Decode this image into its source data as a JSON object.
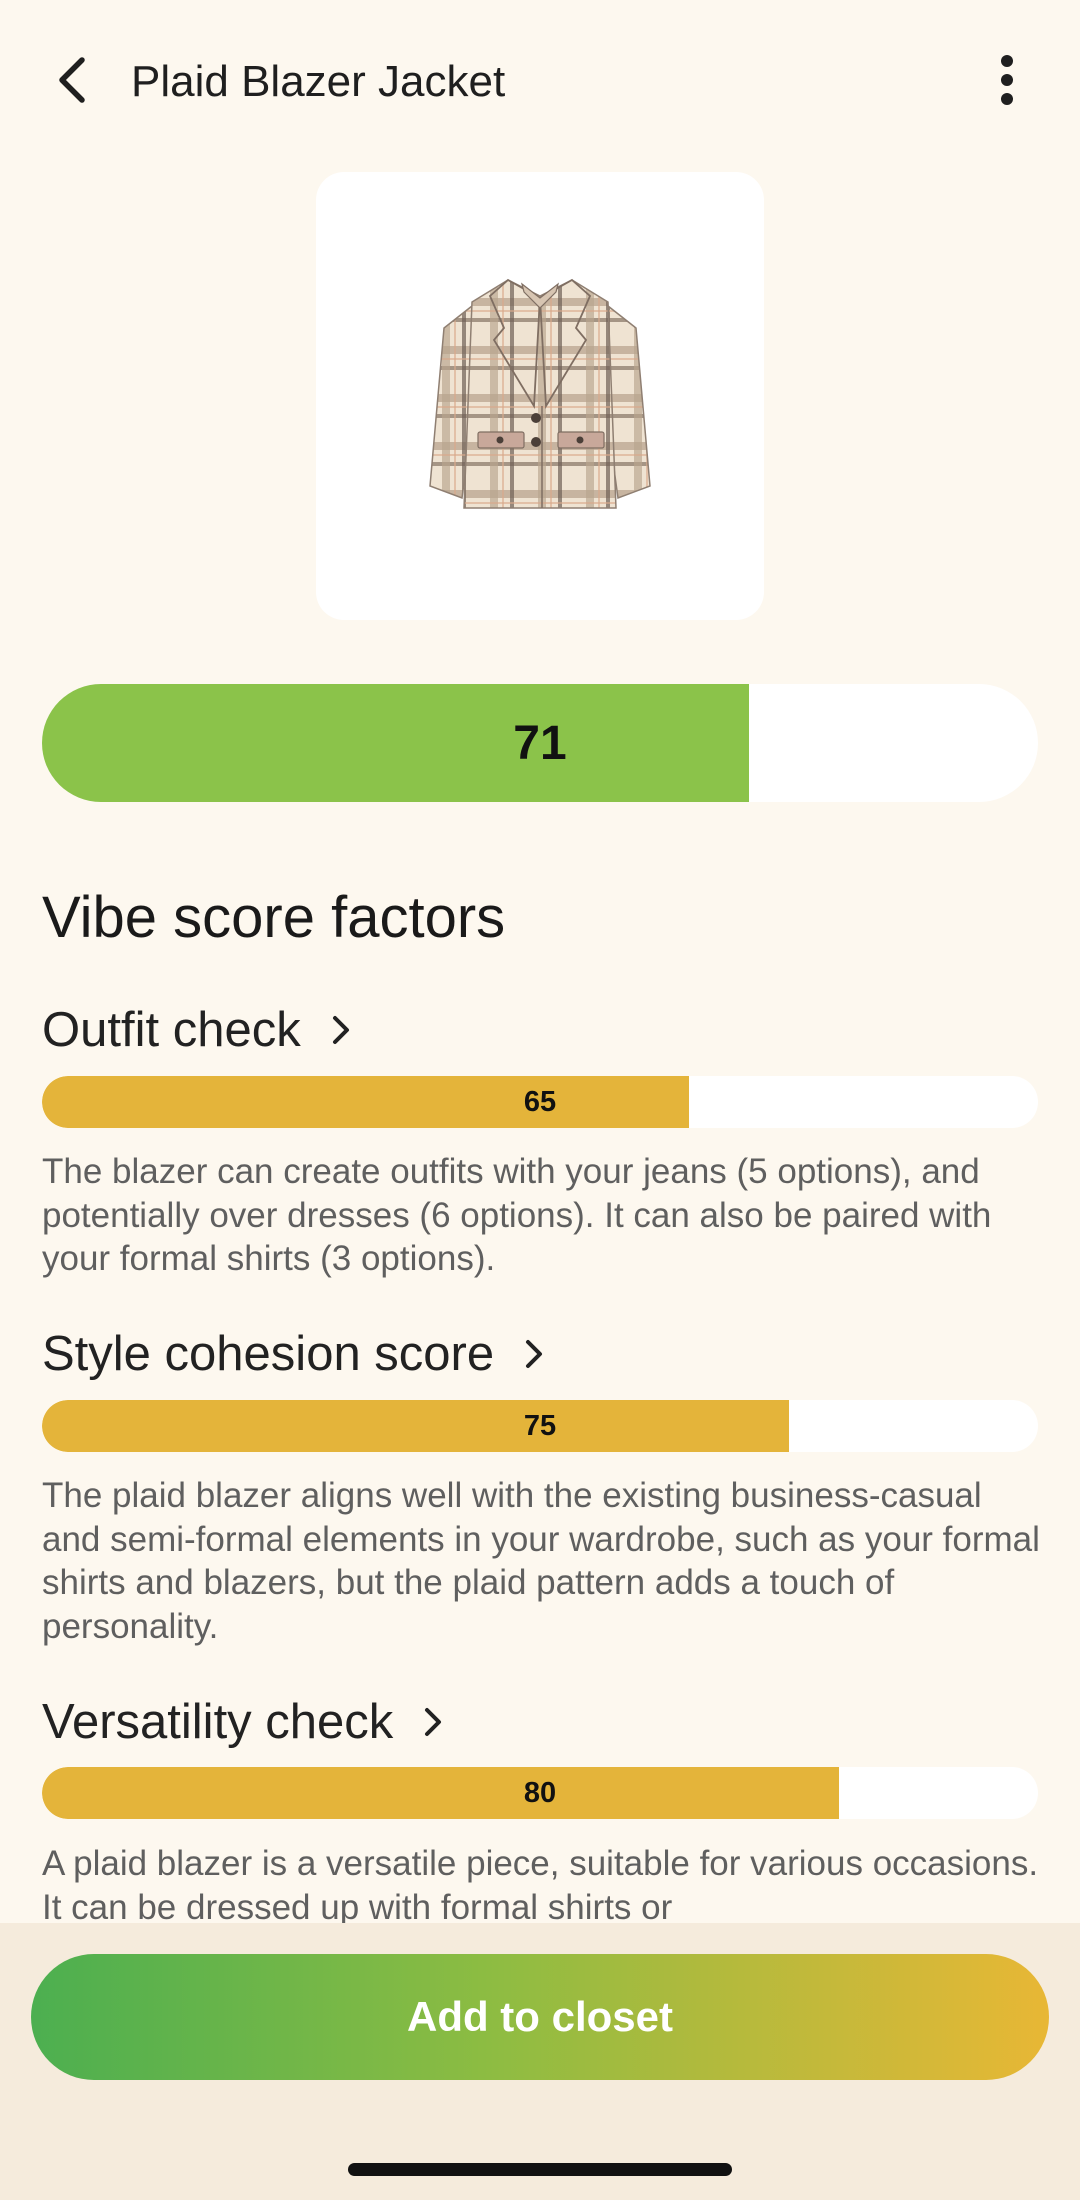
{
  "header": {
    "title": "Plaid Blazer Jacket",
    "back_icon": "chevron-left-icon",
    "more_icon": "more-vertical-icon"
  },
  "product": {
    "image": "plaid-blazer-jacket-image"
  },
  "vibe_score": {
    "value": "71",
    "fraction": 0.71,
    "color": "#8bc34a"
  },
  "factors_section": {
    "title": "Vibe score factors",
    "bar_color": "#e4b43a",
    "items": [
      {
        "title": "Outfit check",
        "score": "65",
        "fraction": 0.65,
        "description": "The blazer can create outfits with your jeans (5 options), and potentially over dresses (6 options). It can also be paired with your formal shirts (3 options)."
      },
      {
        "title": "Style cohesion score",
        "score": "75",
        "fraction": 0.75,
        "description": "The plaid blazer aligns well with the existing business-casual and semi-formal elements in your wardrobe, such as your formal shirts and blazers, but the plaid pattern adds a touch of personality."
      },
      {
        "title": "Versatility check",
        "score": "80",
        "fraction": 0.8,
        "description": "A plaid blazer is a versatile piece, suitable for various occasions. It can be dressed up with formal shirts or"
      }
    ]
  },
  "actions": {
    "add_to_closet_label": "Add to closet"
  }
}
